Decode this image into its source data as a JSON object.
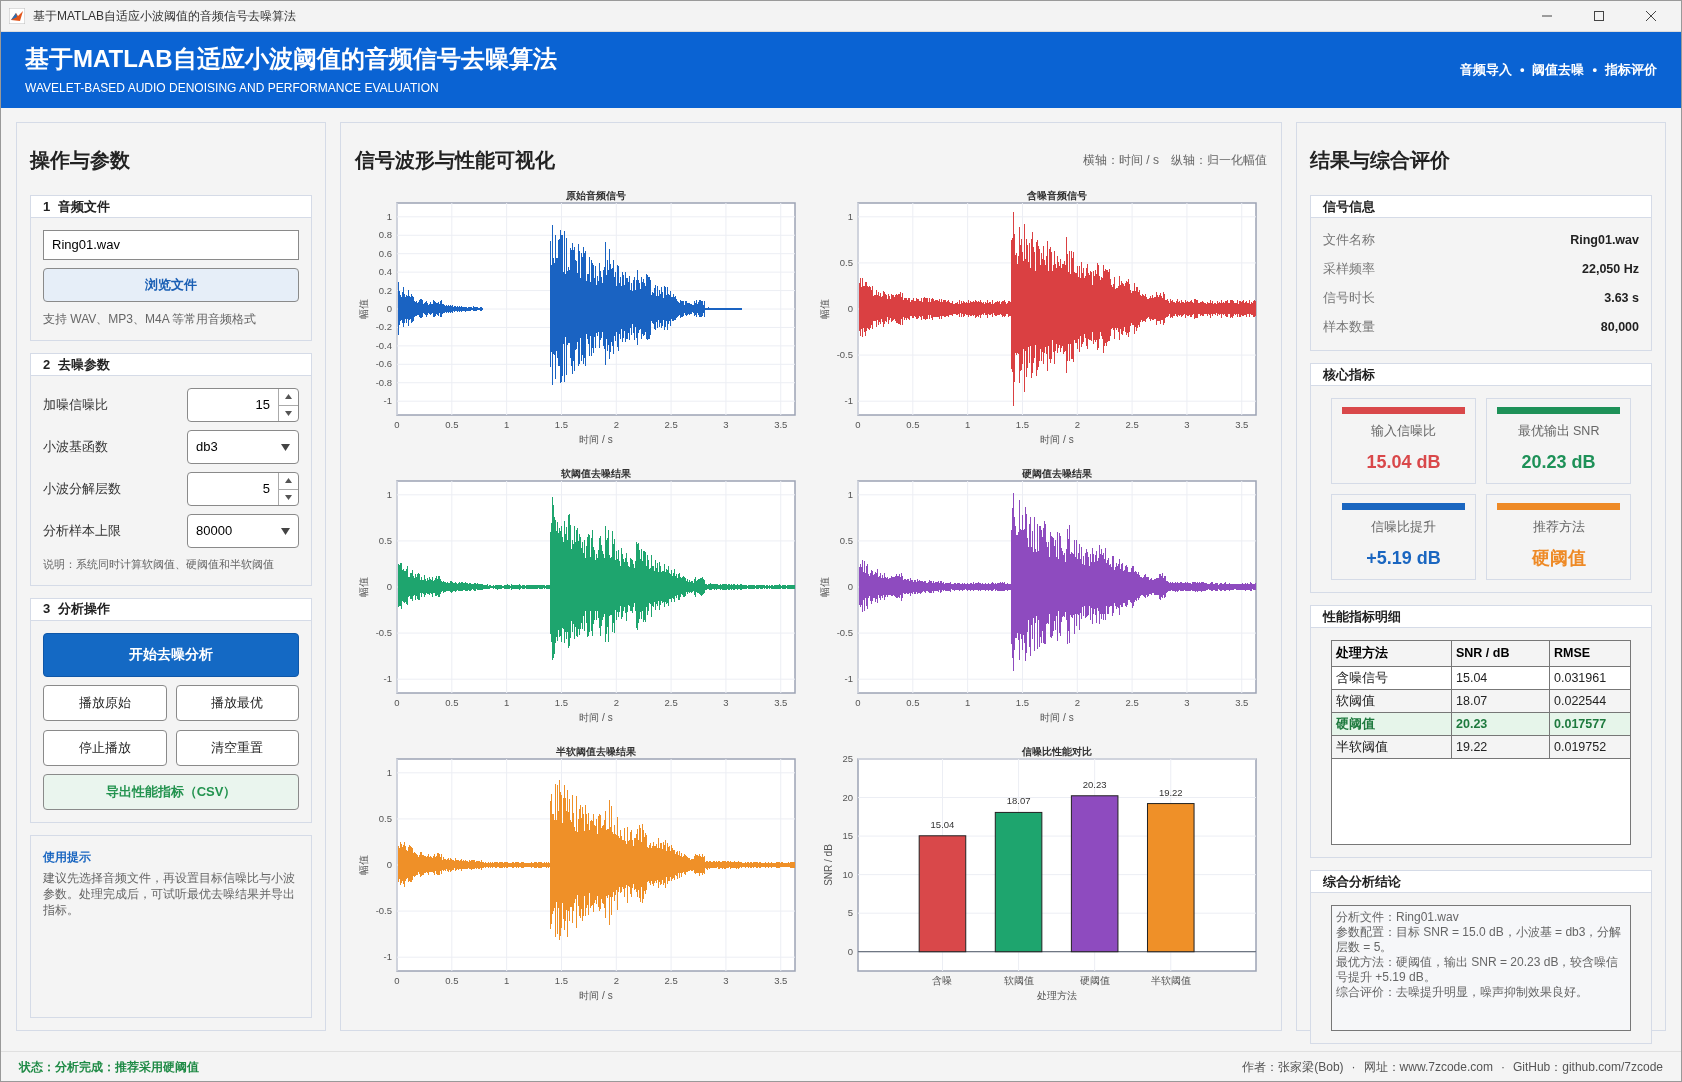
{
  "window": {
    "title": "基于MATLAB自适应小波阈值的音频信号去噪算法"
  },
  "header": {
    "title": "基于MATLAB自适应小波阈值的音频信号去噪算法",
    "subtitle": "WAVELET-BASED AUDIO DENOISING AND PERFORMANCE EVALUATION",
    "nav": [
      "音频导入",
      "阈值去噪",
      "指标评价"
    ],
    "nav_separator": "•"
  },
  "left_panel": {
    "title": "操作与参数",
    "file_section": {
      "number": "1",
      "title": "音频文件",
      "file_value": "Ring01.wav",
      "browse_button": "浏览文件",
      "hint": "支持 WAV、MP3、M4A 等常用音频格式"
    },
    "param_section": {
      "number": "2",
      "title": "去噪参数",
      "fields": [
        {
          "label": "加噪信噪比",
          "kind": "spinner",
          "value": "15"
        },
        {
          "label": "小波基函数",
          "kind": "select",
          "value": "db3"
        },
        {
          "label": "小波分解层数",
          "kind": "spinner",
          "value": "5"
        },
        {
          "label": "分析样本上限",
          "kind": "select",
          "value": "80000"
        }
      ],
      "note": "说明：系统同时计算软阈值、硬阈值和半软阈值"
    },
    "action_section": {
      "number": "3",
      "title": "分析操作",
      "primary_button": "开始去噪分析",
      "buttons": [
        "播放原始",
        "播放最优",
        "停止播放",
        "清空重置"
      ],
      "export_button": "导出性能指标（CSV）"
    },
    "tips": {
      "title": "使用提示",
      "text": "建议先选择音频文件，再设置目标信噪比与小波参数。处理完成后，可试听最优去噪结果并导出指标。"
    }
  },
  "center_panel": {
    "title": "信号波形与性能可视化",
    "axis_notes": [
      "横轴：时间 / s",
      "纵轴：归一化幅值"
    ],
    "waveforms": [
      {
        "kind": "clean",
        "title": "原始音频信号",
        "color": "#1a63c2",
        "xlabel": "时间 / s",
        "ylabel": "幅值",
        "xticks": [
          "0",
          "0.5",
          "1",
          "1.5",
          "2",
          "2.5",
          "3",
          "3.5"
        ],
        "yticks": [
          "1",
          "0.8",
          "0.6",
          "0.4",
          "0.2",
          "0",
          "-0.2",
          "-0.4",
          "-0.6",
          "-0.8",
          "-1"
        ]
      },
      {
        "kind": "noisy",
        "title": "含噪音频信号",
        "color": "#da4042",
        "xlabel": "时间 / s",
        "ylabel": "幅值",
        "xticks": [
          "0",
          "0.5",
          "1",
          "1.5",
          "2",
          "2.5",
          "3",
          "3.5"
        ],
        "yticks": [
          "1",
          "0.5",
          "0",
          "-0.5",
          "-1"
        ]
      },
      {
        "kind": "soft",
        "title": "软阈值去噪结果",
        "color": "#1ea56e",
        "xlabel": "时间 / s",
        "ylabel": "幅值",
        "xticks": [
          "0",
          "0.5",
          "1",
          "1.5",
          "2",
          "2.5",
          "3",
          "3.5"
        ],
        "yticks": [
          "1",
          "0.5",
          "0",
          "-0.5",
          "-1"
        ]
      },
      {
        "kind": "hard",
        "title": "硬阈值去噪结果",
        "color": "#8e4bbf",
        "xlabel": "时间 / s",
        "ylabel": "幅值",
        "xticks": [
          "0",
          "0.5",
          "1",
          "1.5",
          "2",
          "2.5",
          "3",
          "3.5"
        ],
        "yticks": [
          "1",
          "0.5",
          "0",
          "-0.5",
          "-1"
        ]
      },
      {
        "kind": "semisoft",
        "title": "半软阈值去噪结果",
        "color": "#ef9028",
        "xlabel": "时间 / s",
        "ylabel": "幅值",
        "xticks": [
          "0",
          "0.5",
          "1",
          "1.5",
          "2",
          "2.5",
          "3",
          "3.5"
        ],
        "yticks": [
          "1",
          "0.5",
          "0",
          "-0.5",
          "-1"
        ]
      }
    ],
    "chart_data": {
      "type": "bar",
      "title": "信噪比性能对比",
      "xlabel": "处理方法",
      "ylabel": "SNR / dB",
      "categories": [
        "含噪",
        "软阈值",
        "硬阈值",
        "半软阈值"
      ],
      "series": [
        {
          "colors": [
            "#d9484a",
            "#1ea56e",
            "#8e4bbf",
            "#ef9028"
          ],
          "values": [
            15.04,
            18.07,
            20.23,
            19.22
          ]
        }
      ],
      "ylim": [
        -2.5,
        25
      ],
      "yticks": [
        0,
        5,
        10,
        15,
        20,
        25
      ],
      "grid": true,
      "data_labels": true
    }
  },
  "right_panel": {
    "title": "结果与综合评价",
    "info": {
      "title": "信号信息",
      "rows": [
        {
          "label": "文件名称",
          "value": "Ring01.wav"
        },
        {
          "label": "采样频率",
          "value": "22,050 Hz"
        },
        {
          "label": "信号时长",
          "value": "3.63 s"
        },
        {
          "label": "样本数量",
          "value": "80,000"
        }
      ]
    },
    "metrics": {
      "title": "核心指标",
      "cards": [
        {
          "label": "输入信噪比",
          "value": "15.04 dB",
          "color": "#d9484a"
        },
        {
          "label": "最优输出 SNR",
          "value": "20.23 dB",
          "color": "#1e9158"
        },
        {
          "label": "信噪比提升",
          "value": "+5.19 dB",
          "color": "#1a66c0"
        },
        {
          "label": "推荐方法",
          "value": "硬阈值",
          "color": "#ee8a26"
        }
      ]
    },
    "table": {
      "title": "性能指标明细",
      "columns": [
        "处理方法",
        "SNR / dB",
        "RMSE"
      ],
      "rows": [
        {
          "cells": [
            "含噪信号",
            "15.04",
            "0.031961"
          ],
          "selected": false
        },
        {
          "cells": [
            "软阈值",
            "18.07",
            "0.022544"
          ],
          "selected": false
        },
        {
          "cells": [
            "硬阈值",
            "20.23",
            "0.017577"
          ],
          "selected": true
        },
        {
          "cells": [
            "半软阈值",
            "19.22",
            "0.019752"
          ],
          "selected": false
        }
      ]
    },
    "conclusion": {
      "title": "综合分析结论",
      "lines": [
        "分析文件：Ring01.wav",
        "参数配置：目标 SNR = 15.0 dB，小波基 = db3，分解层数 = 5。",
        "最优方法：硬阈值，输出 SNR = 20.23 dB，较含噪信号提升 +5.19 dB。",
        "综合评价：去噪提升明显，噪声抑制效果良好。"
      ]
    }
  },
  "status_bar": {
    "status": "状态：分析完成：推荐采用硬阈值",
    "credits": [
      "作者：张家梁(Bob)",
      "网址：www.7zcode.com",
      "GitHub：github.com/7zcode"
    ],
    "separator": "·"
  }
}
